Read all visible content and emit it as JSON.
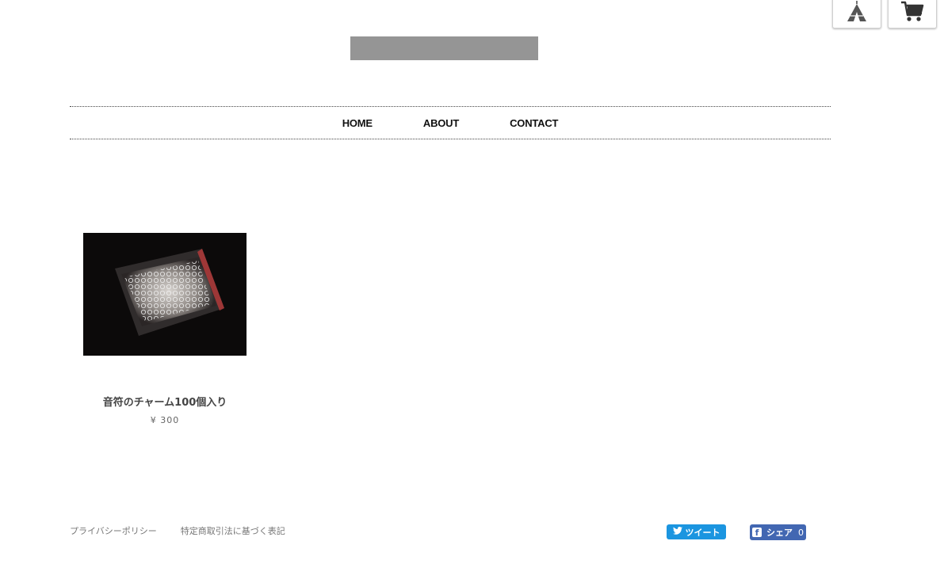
{
  "header": {
    "base_icon": "tent-icon",
    "cart_icon": "shopping-cart-icon",
    "logo_color": "#959595"
  },
  "nav": {
    "items": [
      {
        "label": "HOME"
      },
      {
        "label": "ABOUT"
      },
      {
        "label": "CONTACT"
      }
    ]
  },
  "products": [
    {
      "name": "音符のチャーム100個入り",
      "price": "¥ 300"
    }
  ],
  "footer": {
    "links": [
      "プライバシーポリシー",
      "特定商取引法に基づく表記"
    ],
    "tweet_label": "ツイート",
    "share_label": "シェア",
    "share_count": "0"
  },
  "colors": {
    "twitter": "#1b95e0",
    "facebook": "#4267b2"
  }
}
